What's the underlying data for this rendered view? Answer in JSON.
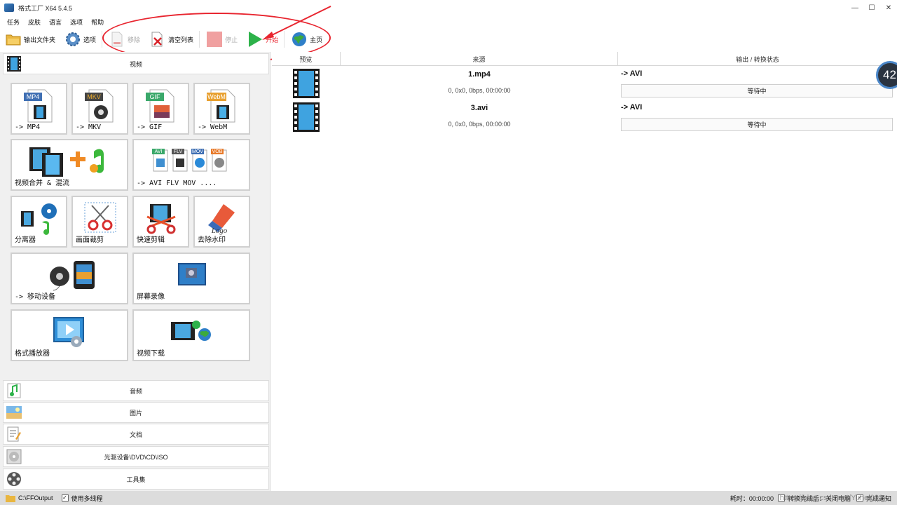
{
  "window": {
    "title": "格式工厂 X64 5.4.5",
    "minimize": "—",
    "maximize": "☐",
    "close": "✕"
  },
  "menu": [
    "任务",
    "皮肤",
    "语言",
    "选项",
    "帮助"
  ],
  "toolbar": {
    "output_folder": "输出文件夹",
    "options": "选项",
    "remove": "移除",
    "clear_list": "清空列表",
    "stop": "停止",
    "start": "开始",
    "home": "主页"
  },
  "categories": {
    "video": "视频",
    "audio": "音频",
    "picture": "图片",
    "document": "文档",
    "optical": "光驱设备\\DVD\\CD\\ISO",
    "tools": "工具集"
  },
  "video_tiles": {
    "mp4": "-> MP4",
    "mp4_tag": "MP4",
    "mkv": "-> MKV",
    "mkv_tag": "MKV",
    "gif": "-> GIF",
    "gif_tag": "GIF",
    "webm": "-> WebM",
    "webm_tag": "WebM",
    "merge": "视频合并 & 混流",
    "multi": "-> AVI FLV MOV ....",
    "multi_tags": [
      "AVI",
      "FLV",
      "MOV",
      "VOB"
    ],
    "splitter": "分离器",
    "crop": "画面裁剪",
    "quick_clip": "快速剪辑",
    "remove_watermark": "去除水印",
    "logo_text": "Logo",
    "mobile": "-> 移动设备",
    "screen_record": "屏幕录像",
    "player": "格式播放器",
    "download": "视频下载"
  },
  "table": {
    "columns": [
      "预览",
      "来源",
      "输出 / 转换状态"
    ],
    "rows": [
      {
        "name": "1.mp4",
        "info": "0, 0x0, 0bps, 00:00:00",
        "target": "-> AVI",
        "status": "等待中"
      },
      {
        "name": "3.avi",
        "info": "0, 0x0, 0bps, 00:00:00",
        "target": "-> AVI",
        "status": "等待中"
      }
    ]
  },
  "badge": "42",
  "statusbar": {
    "output_path": "C:\\FFOutput",
    "multithread": "使用多线程",
    "elapsed": "耗时：00:00:00",
    "after_convert": "转换完成后：关闭电脑",
    "notify": "完成通知"
  },
  "watermark": "https://blog.csdn.net/Yuhei001",
  "colors": {
    "annotation": "#e8252f",
    "start_green": "#2db24a",
    "stop_red": "#f0a0a0",
    "statusbar": "#dcdcdc"
  }
}
